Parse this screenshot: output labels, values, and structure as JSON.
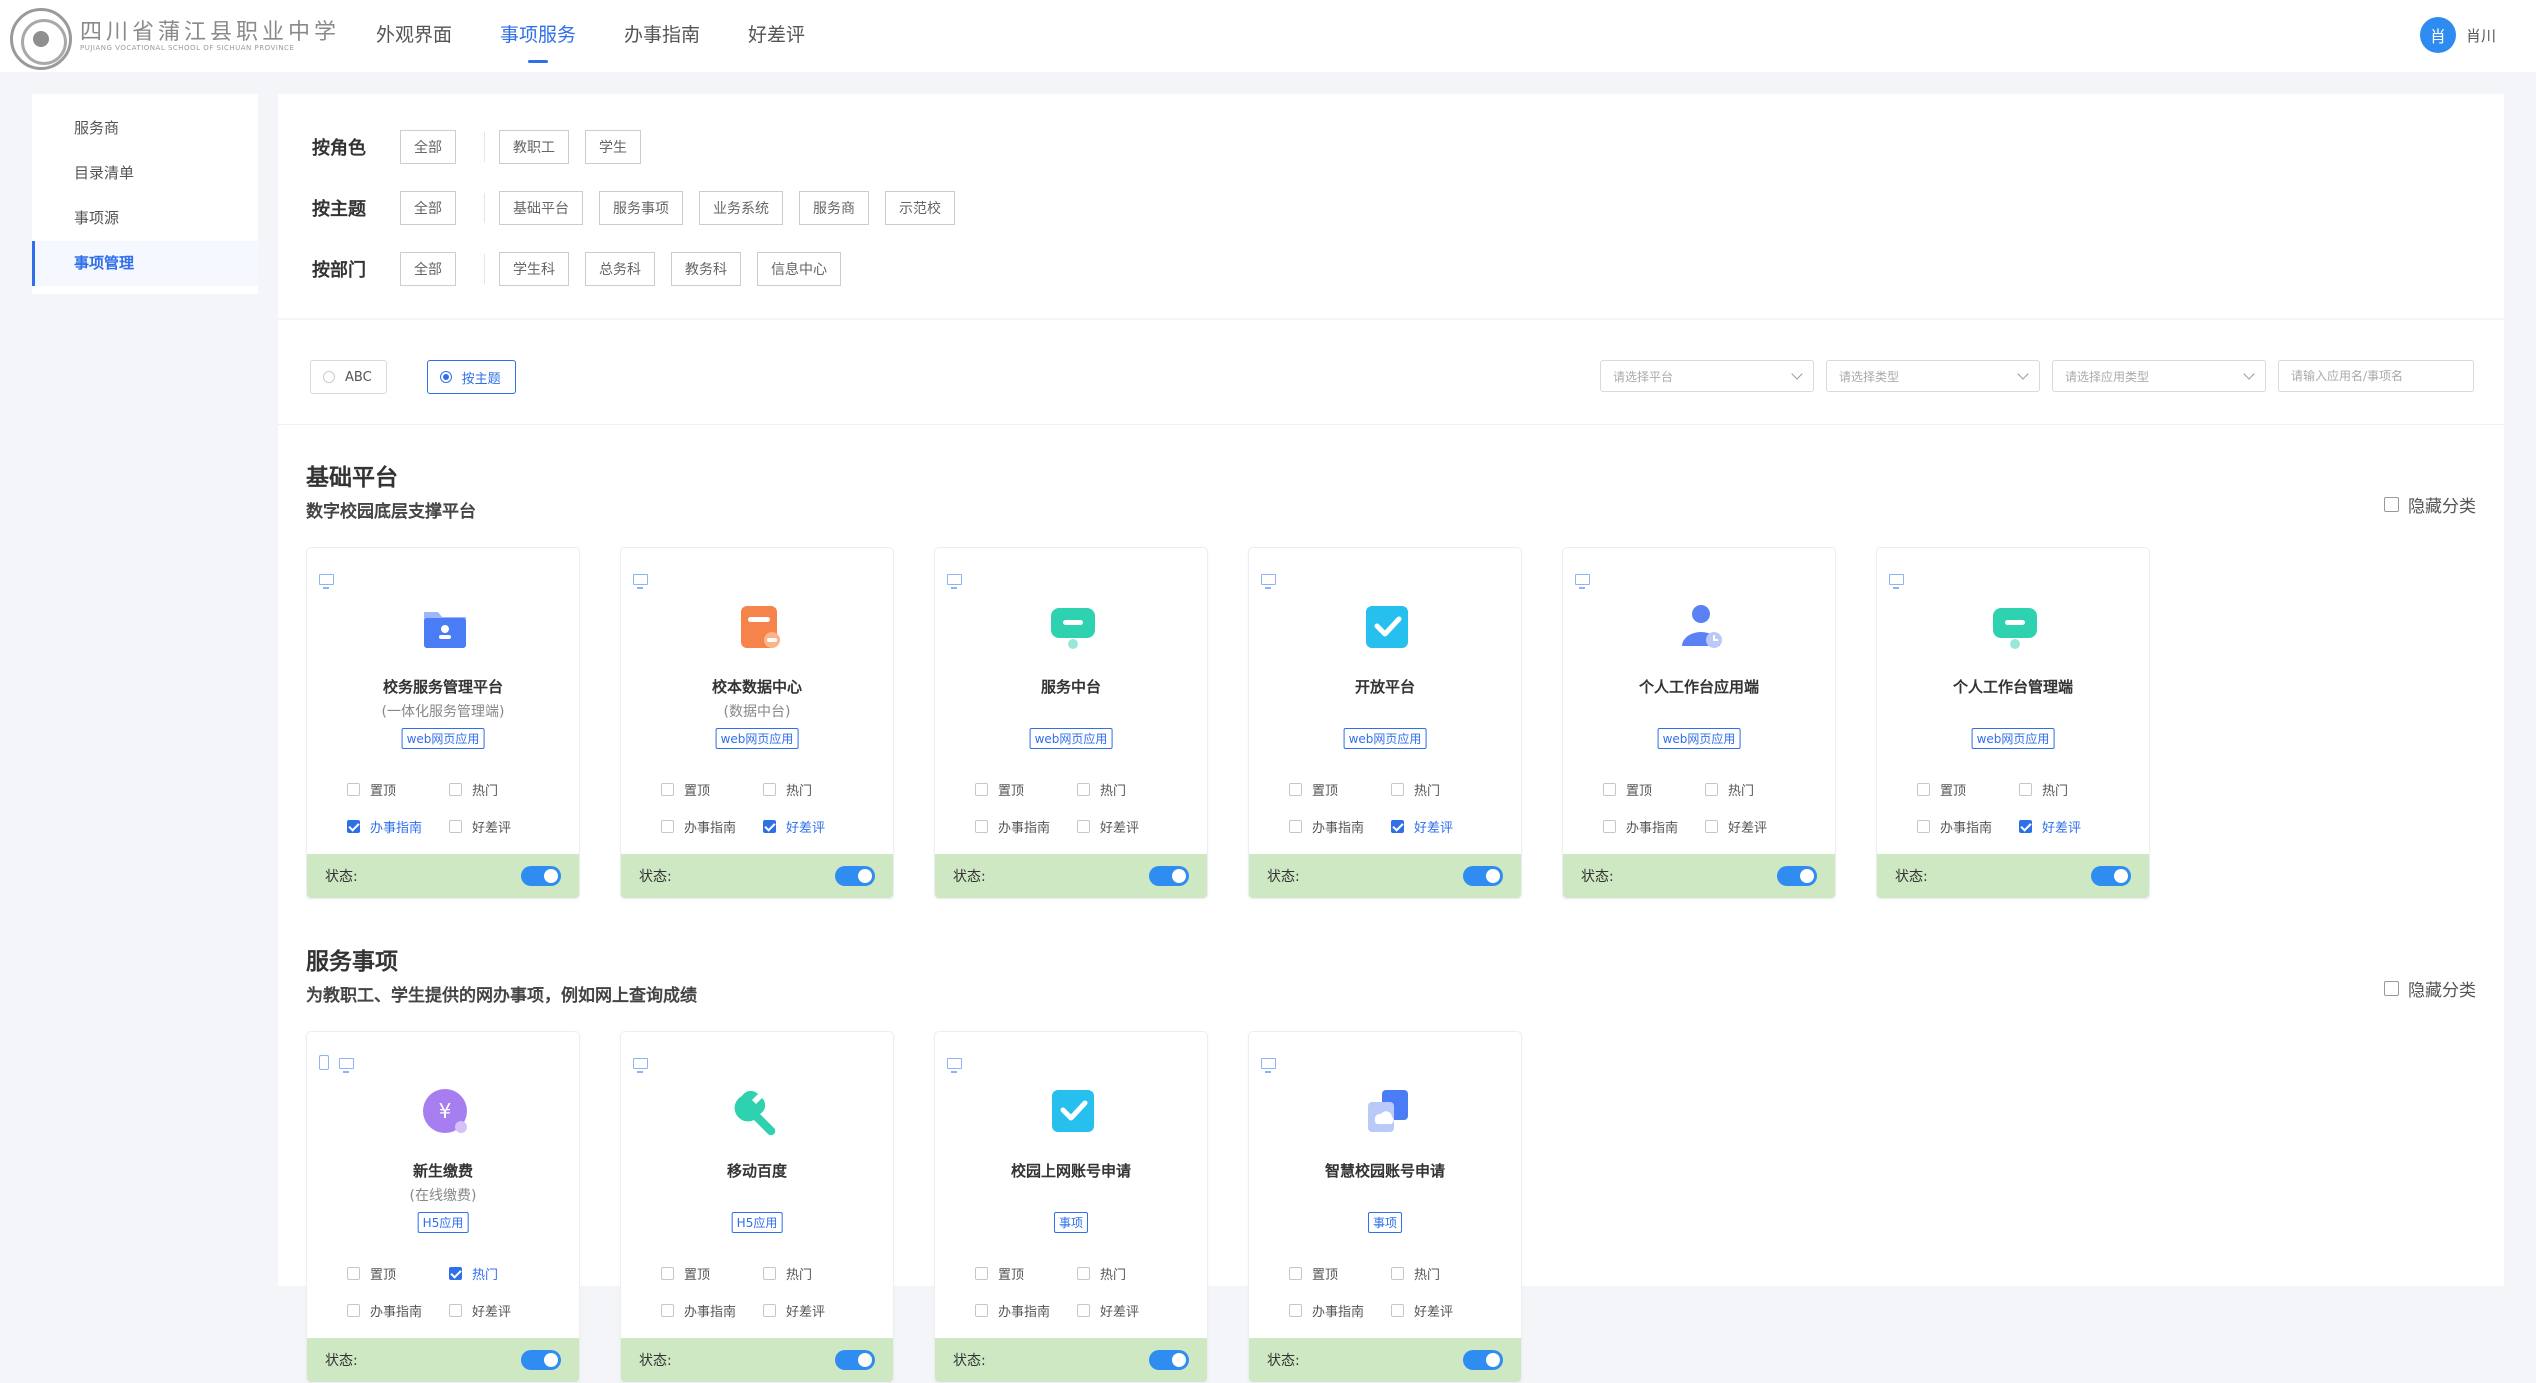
{
  "header": {
    "school_name": "四川省蒲江县职业中学",
    "school_en": "PUJIANG VOCATIONAL SCHOOL OF SICHUAN PROVINCE",
    "nav": [
      "外观界面",
      "事项服务",
      "办事指南",
      "好差评"
    ],
    "active_nav": "事项服务",
    "user_avatar": "肖",
    "user_name": "肖川"
  },
  "sidebar": {
    "items": [
      {
        "label": "服务商"
      },
      {
        "label": "目录清单"
      },
      {
        "label": "事项源"
      },
      {
        "label": "事项管理"
      }
    ],
    "active": "事项管理"
  },
  "filters": {
    "role": {
      "label": "按角色",
      "all": "全部",
      "options": [
        "教职工",
        "学生"
      ]
    },
    "theme": {
      "label": "按主题",
      "all": "全部",
      "options": [
        "基础平台",
        "服务事项",
        "业务系统",
        "服务商",
        "示范校"
      ]
    },
    "dept": {
      "label": "按部门",
      "all": "全部",
      "options": [
        "学生科",
        "总务科",
        "教务科",
        "信息中心"
      ]
    }
  },
  "toolbar": {
    "sort_abc": "ABC",
    "sort_theme": "按主题",
    "sort_selected": "按主题",
    "select_platform": "请选择平台",
    "select_type": "请选择类型",
    "select_app_type": "请选择应用类型",
    "search_placeholder": "请输入应用名/事项名"
  },
  "status_label": "状态:",
  "option_labels": {
    "top": "置顶",
    "hot": "热门",
    "guide": "办事指南",
    "rating": "好差评"
  },
  "sections": [
    {
      "title": "基础平台",
      "subtitle": "数字校园底层支撑平台",
      "hide_label": "隐藏分类",
      "cards": [
        {
          "name": "校务服务管理平台",
          "sub": "(一体化服务管理端)",
          "tag": "web网页应用",
          "icon": "folder-user-icon",
          "color": "#4a7cf6",
          "platforms": [
            "monitor"
          ],
          "top": false,
          "hot": false,
          "guide": true,
          "rating": false,
          "enabled": true
        },
        {
          "name": "校本数据中心",
          "sub": "(数据中台)",
          "tag": "web网页应用",
          "icon": "data-box-icon",
          "color": "#f5834a",
          "platforms": [
            "monitor"
          ],
          "top": false,
          "hot": false,
          "guide": false,
          "rating": true,
          "enabled": true
        },
        {
          "name": "服务中台",
          "sub": "",
          "tag": "web网页应用",
          "icon": "chat-monitor-icon",
          "color": "#2fd2b0",
          "platforms": [
            "monitor"
          ],
          "top": false,
          "hot": false,
          "guide": false,
          "rating": false,
          "enabled": true
        },
        {
          "name": "开放平台",
          "sub": "",
          "tag": "web网页应用",
          "icon": "check-square-icon",
          "color": "#27c0ee",
          "platforms": [
            "monitor"
          ],
          "top": false,
          "hot": false,
          "guide": false,
          "rating": true,
          "enabled": true
        },
        {
          "name": "个人工作台应用端",
          "sub": "",
          "tag": "web网页应用",
          "icon": "user-clock-icon",
          "color": "#5a82f5",
          "platforms": [
            "monitor"
          ],
          "top": false,
          "hot": false,
          "guide": false,
          "rating": false,
          "enabled": true
        },
        {
          "name": "个人工作台管理端",
          "sub": "",
          "tag": "web网页应用",
          "icon": "chat-monitor-icon",
          "color": "#2fd2b0",
          "platforms": [
            "monitor"
          ],
          "top": false,
          "hot": false,
          "guide": false,
          "rating": true,
          "enabled": true
        }
      ]
    },
    {
      "title": "服务事项",
      "subtitle": "为教职工、学生提供的网办事项，例如网上查询成绩",
      "hide_label": "隐藏分类",
      "cards": [
        {
          "name": "新生缴费",
          "sub": "(在线缴费)",
          "tag": "H5应用",
          "icon": "yuan-coin-icon",
          "color": "#a77ef0",
          "platforms": [
            "phone",
            "monitor"
          ],
          "top": false,
          "hot": true,
          "guide": false,
          "rating": false,
          "enabled": true
        },
        {
          "name": "移动百度",
          "sub": "",
          "tag": "H5应用",
          "icon": "wrench-icon",
          "color": "#2fd2b0",
          "platforms": [
            "monitor"
          ],
          "top": false,
          "hot": false,
          "guide": false,
          "rating": false,
          "enabled": true
        },
        {
          "name": "校园上网账号申请",
          "sub": "",
          "tag": "事项",
          "icon": "check-square-icon",
          "color": "#27c0ee",
          "platforms": [
            "monitor"
          ],
          "top": false,
          "hot": false,
          "guide": false,
          "rating": false,
          "enabled": true
        },
        {
          "name": "智慧校园账号申请",
          "sub": "",
          "tag": "事项",
          "icon": "cloud-stack-icon",
          "color": "#4a7cf6",
          "platforms": [
            "monitor"
          ],
          "top": false,
          "hot": false,
          "guide": false,
          "rating": false,
          "enabled": true
        }
      ]
    }
  ]
}
